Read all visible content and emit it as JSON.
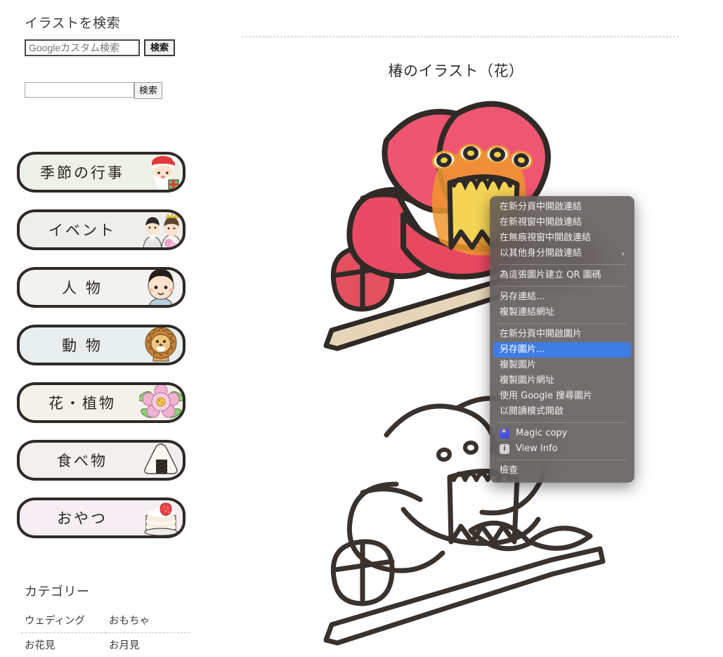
{
  "sidebar": {
    "heading": "イラストを検索",
    "search_google": {
      "placeholder": "Googleカスタム検索",
      "value": "",
      "button_label": "検索"
    },
    "search_site": {
      "placeholder": "",
      "value": "",
      "button_label": "検索"
    },
    "nav_buttons": [
      {
        "label": "季節の行事",
        "icon": "santa-claus-icon",
        "tint": "tint-green"
      },
      {
        "label": "イベント",
        "icon": "wedding-couple-icon",
        "tint": "tint-grey"
      },
      {
        "label": "人 物",
        "icon": "boy-face-icon",
        "tint": "tint-white"
      },
      {
        "label": "動 物",
        "icon": "lion-icon",
        "tint": "tint-blue"
      },
      {
        "label": "花・植物",
        "icon": "peony-flower-icon",
        "tint": "tint-cream"
      },
      {
        "label": "食べ物",
        "icon": "onigiri-icon",
        "tint": "tint-plain"
      },
      {
        "label": "おやつ",
        "icon": "shortcake-icon",
        "tint": "tint-pink"
      }
    ],
    "category_heading": "カテゴリー",
    "categories": [
      [
        "ウェディング",
        "おもちゃ"
      ],
      [
        "お花見",
        "お月見"
      ]
    ]
  },
  "main": {
    "title": "椿のイラスト（花）",
    "illustration_color_alt": "camellia-flower-color-illustration",
    "illustration_line_alt": "camellia-flower-line-illustration"
  },
  "context_menu": {
    "highlight_color": "#3f7ce4",
    "items": [
      {
        "label": "在新分頁中開啟連結",
        "type": "item"
      },
      {
        "label": "在新視窗中開啟連結",
        "type": "item"
      },
      {
        "label": "在無痕視窗中開啟連結",
        "type": "item"
      },
      {
        "label": "以其他身分開啟連結",
        "type": "submenu",
        "chevron": "›"
      },
      {
        "type": "separator"
      },
      {
        "label": "為這張圖片建立 QR 圖碼",
        "type": "item"
      },
      {
        "type": "separator"
      },
      {
        "label": "另存連結...",
        "type": "item"
      },
      {
        "label": "複製連結網址",
        "type": "item"
      },
      {
        "type": "separator"
      },
      {
        "label": "在新分頁中開啟圖片",
        "type": "item"
      },
      {
        "label": "另存圖片...",
        "type": "item",
        "selected": true
      },
      {
        "label": "複製圖片",
        "type": "item"
      },
      {
        "label": "複製圖片網址",
        "type": "item"
      },
      {
        "label": "使用 Google 搜尋圖片",
        "type": "item"
      },
      {
        "label": "以閱讀模式開啟",
        "type": "item"
      },
      {
        "type": "separator"
      },
      {
        "label": "Magic copy",
        "type": "item",
        "icon": "magic-wand-icon"
      },
      {
        "label": "View Info",
        "type": "item",
        "icon": "info-icon"
      },
      {
        "type": "separator"
      },
      {
        "label": "檢查",
        "type": "item"
      }
    ]
  }
}
